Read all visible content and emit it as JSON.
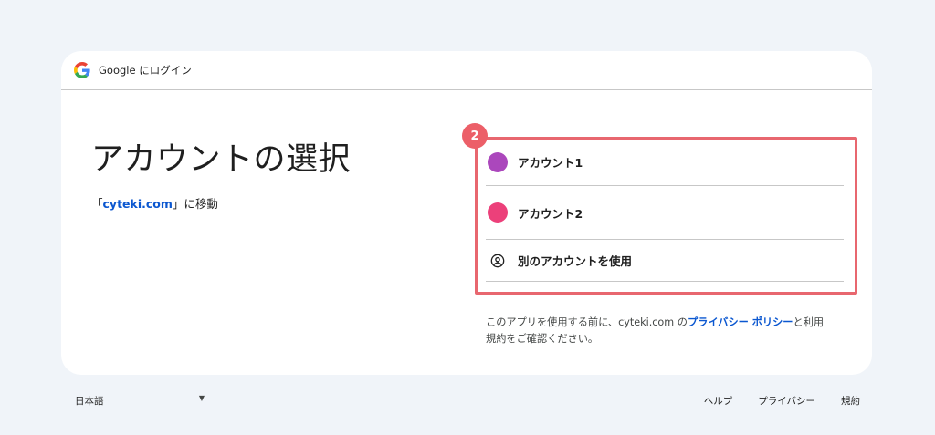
{
  "header": {
    "title": "Google にログイン",
    "logo_icon": "google-g-icon"
  },
  "main": {
    "title": "アカウントの選択",
    "subtitle_prefix": "「",
    "subtitle_link": "cyteki.com",
    "subtitle_suffix": "」に移動"
  },
  "annotation": {
    "step": "2",
    "color": "#e8676f"
  },
  "accounts": [
    {
      "label": "アカウント1",
      "avatar_color": "#ab47bc"
    },
    {
      "label": "アカウント2",
      "avatar_color": "#ec407a"
    }
  ],
  "other_account": {
    "label": "別のアカウントを使用",
    "icon": "user-circle-icon"
  },
  "terms": {
    "prefix": "このアプリを使用する前に、cyteki.com の",
    "privacy_link": "プライバシー ポリシー",
    "middle": "と利用",
    "suffix": "規約をご確認ください。"
  },
  "footer": {
    "language": "日本語",
    "links": [
      "ヘルプ",
      "プライバシー",
      "規約"
    ]
  }
}
